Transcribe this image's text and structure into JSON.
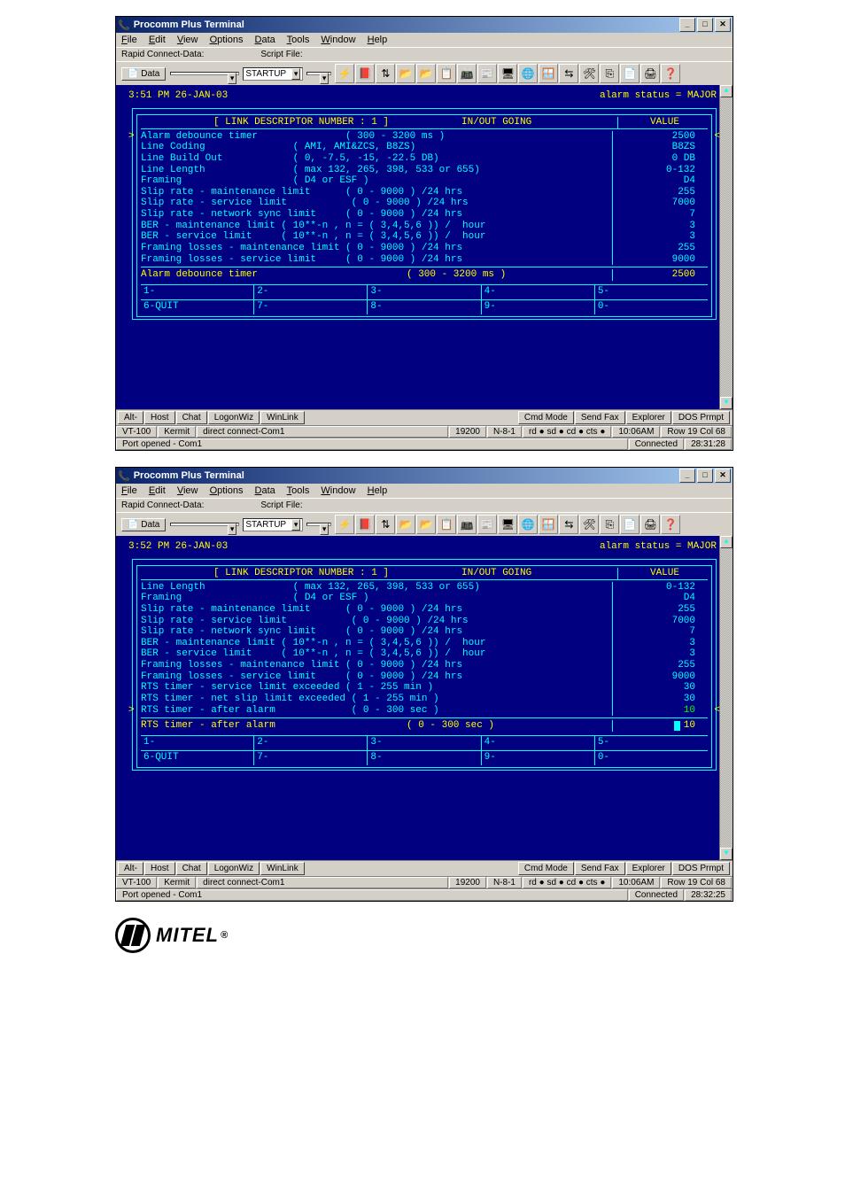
{
  "app_title": "Procomm Plus Terminal",
  "menus": {
    "file": "File",
    "edit": "Edit",
    "view": "View",
    "options": "Options",
    "data": "Data",
    "tools": "Tools",
    "window": "Window",
    "help": "Help"
  },
  "toolbar_labels": {
    "rapid": "Rapid Connect-Data:",
    "data_btn": "Data",
    "script": "Script File:",
    "startup": "STARTUP"
  },
  "strip_buttons": {
    "alt": "Alt-",
    "host": "Host",
    "chat": "Chat",
    "logon": "LogonWiz",
    "winlink": "WinLink",
    "cmd": "Cmd Mode",
    "sendfax": "Send Fax",
    "explorer": "Explorer",
    "dos": "DOS Prmpt"
  },
  "status": {
    "vt": "VT-100",
    "kermit": "Kermit",
    "conn": "direct connect-Com1",
    "baud": "19200",
    "params": "N-8-1",
    "sig": "rd ● sd ● cd ● cts ●",
    "rowcol1": "Row 19  Col 68",
    "rowcol2": "Row 19  Col 68",
    "time1": "10:06AM",
    "time2": "10:06AM",
    "connected": "Connected",
    "elapsed1": "28:31:28",
    "elapsed2": "28:32:25",
    "port": "Port opened - Com1"
  },
  "screen1": {
    "time": "3:51 PM  26-JAN-03",
    "alarm": "alarm status = MAJOR",
    "hdr_link": "[  LINK DESCRIPTOR NUMBER :  1 ]",
    "hdr_io": "IN/OUT GOING",
    "hdr_val": "VALUE",
    "lines": [
      {
        "left": "Alarm debounce timer               ( 300 - 3200 ms )",
        "val": "2500"
      },
      {
        "left": "Line Coding               ( AMI, AMI&ZCS, B8ZS)",
        "val": "B8ZS"
      },
      {
        "left": "Line Build Out            ( 0, -7.5, -15, -22.5 DB)",
        "val": "0 DB"
      },
      {
        "left": "Line Length               ( max 132, 265, 398, 533 or 655)",
        "val": "0-132"
      },
      {
        "left": "Framing                   ( D4 or ESF )",
        "val": "D4"
      },
      {
        "left": "Slip rate - maintenance limit      ( 0 - 9000 ) /24 hrs",
        "val": "255"
      },
      {
        "left": "Slip rate - service limit           ( 0 - 9000 ) /24 hrs",
        "val": "7000"
      },
      {
        "left": "Slip rate - network sync limit     ( 0 - 9000 ) /24 hrs",
        "val": "7"
      },
      {
        "left": "BER - maintenance limit ( 10**-n , n = ( 3,4,5,6 )) /  hour",
        "val": "3"
      },
      {
        "left": "BER - service limit     ( 10**-n , n = ( 3,4,5,6 )) /  hour",
        "val": "3"
      },
      {
        "left": "Framing losses - maintenance limit ( 0 - 9000 ) /24 hrs",
        "val": "255"
      },
      {
        "left": "Framing losses - service limit     ( 0 - 9000 ) /24 hrs",
        "val": "9000"
      }
    ],
    "edit": {
      "left": "Alarm debounce timer",
      "range": "( 300 - 3200 ms )",
      "val": "2500"
    },
    "fkeys": [
      [
        "1-",
        "2-",
        "3-",
        "4-",
        "5-"
      ],
      [
        "6-QUIT",
        "7-",
        "8-",
        "9-",
        "0-"
      ]
    ]
  },
  "screen2": {
    "time": "3:52 PM  26-JAN-03",
    "alarm": "alarm status = MAJOR",
    "hdr_link": "[  LINK DESCRIPTOR NUMBER :  1 ]",
    "hdr_io": "IN/OUT GOING",
    "hdr_val": "VALUE",
    "lines": [
      {
        "left": "Line Length               ( max 132, 265, 398, 533 or 655)",
        "val": "0-132"
      },
      {
        "left": "Framing                   ( D4 or ESF )",
        "val": "D4"
      },
      {
        "left": "Slip rate - maintenance limit      ( 0 - 9000 ) /24 hrs",
        "val": "255"
      },
      {
        "left": "Slip rate - service limit           ( 0 - 9000 ) /24 hrs",
        "val": "7000"
      },
      {
        "left": "Slip rate - network sync limit     ( 0 - 9000 ) /24 hrs",
        "val": "7"
      },
      {
        "left": "BER - maintenance limit ( 10**-n , n = ( 3,4,5,6 )) /  hour",
        "val": "3"
      },
      {
        "left": "BER - service limit     ( 10**-n , n = ( 3,4,5,6 )) /  hour",
        "val": "3"
      },
      {
        "left": "Framing losses - maintenance limit ( 0 - 9000 ) /24 hrs",
        "val": "255"
      },
      {
        "left": "Framing losses - service limit     ( 0 - 9000 ) /24 hrs",
        "val": "9000"
      },
      {
        "left": "RTS timer - service limit exceeded ( 1 - 255 min )",
        "val": "30"
      },
      {
        "left": "RTS timer - net slip limit exceeded ( 1 - 255 min )",
        "val": "30"
      },
      {
        "left": "RTS timer - after alarm             ( 0 - 300 sec )",
        "val": "10"
      }
    ],
    "edit": {
      "left": "RTS timer - after alarm",
      "range": "( 0 - 300 sec )",
      "val": "10"
    },
    "fkeys": [
      [
        "1-",
        "2-",
        "3-",
        "4-",
        "5-"
      ],
      [
        "6-QUIT",
        "7-",
        "8-",
        "9-",
        "0-"
      ]
    ]
  },
  "mitel": "MITEL"
}
